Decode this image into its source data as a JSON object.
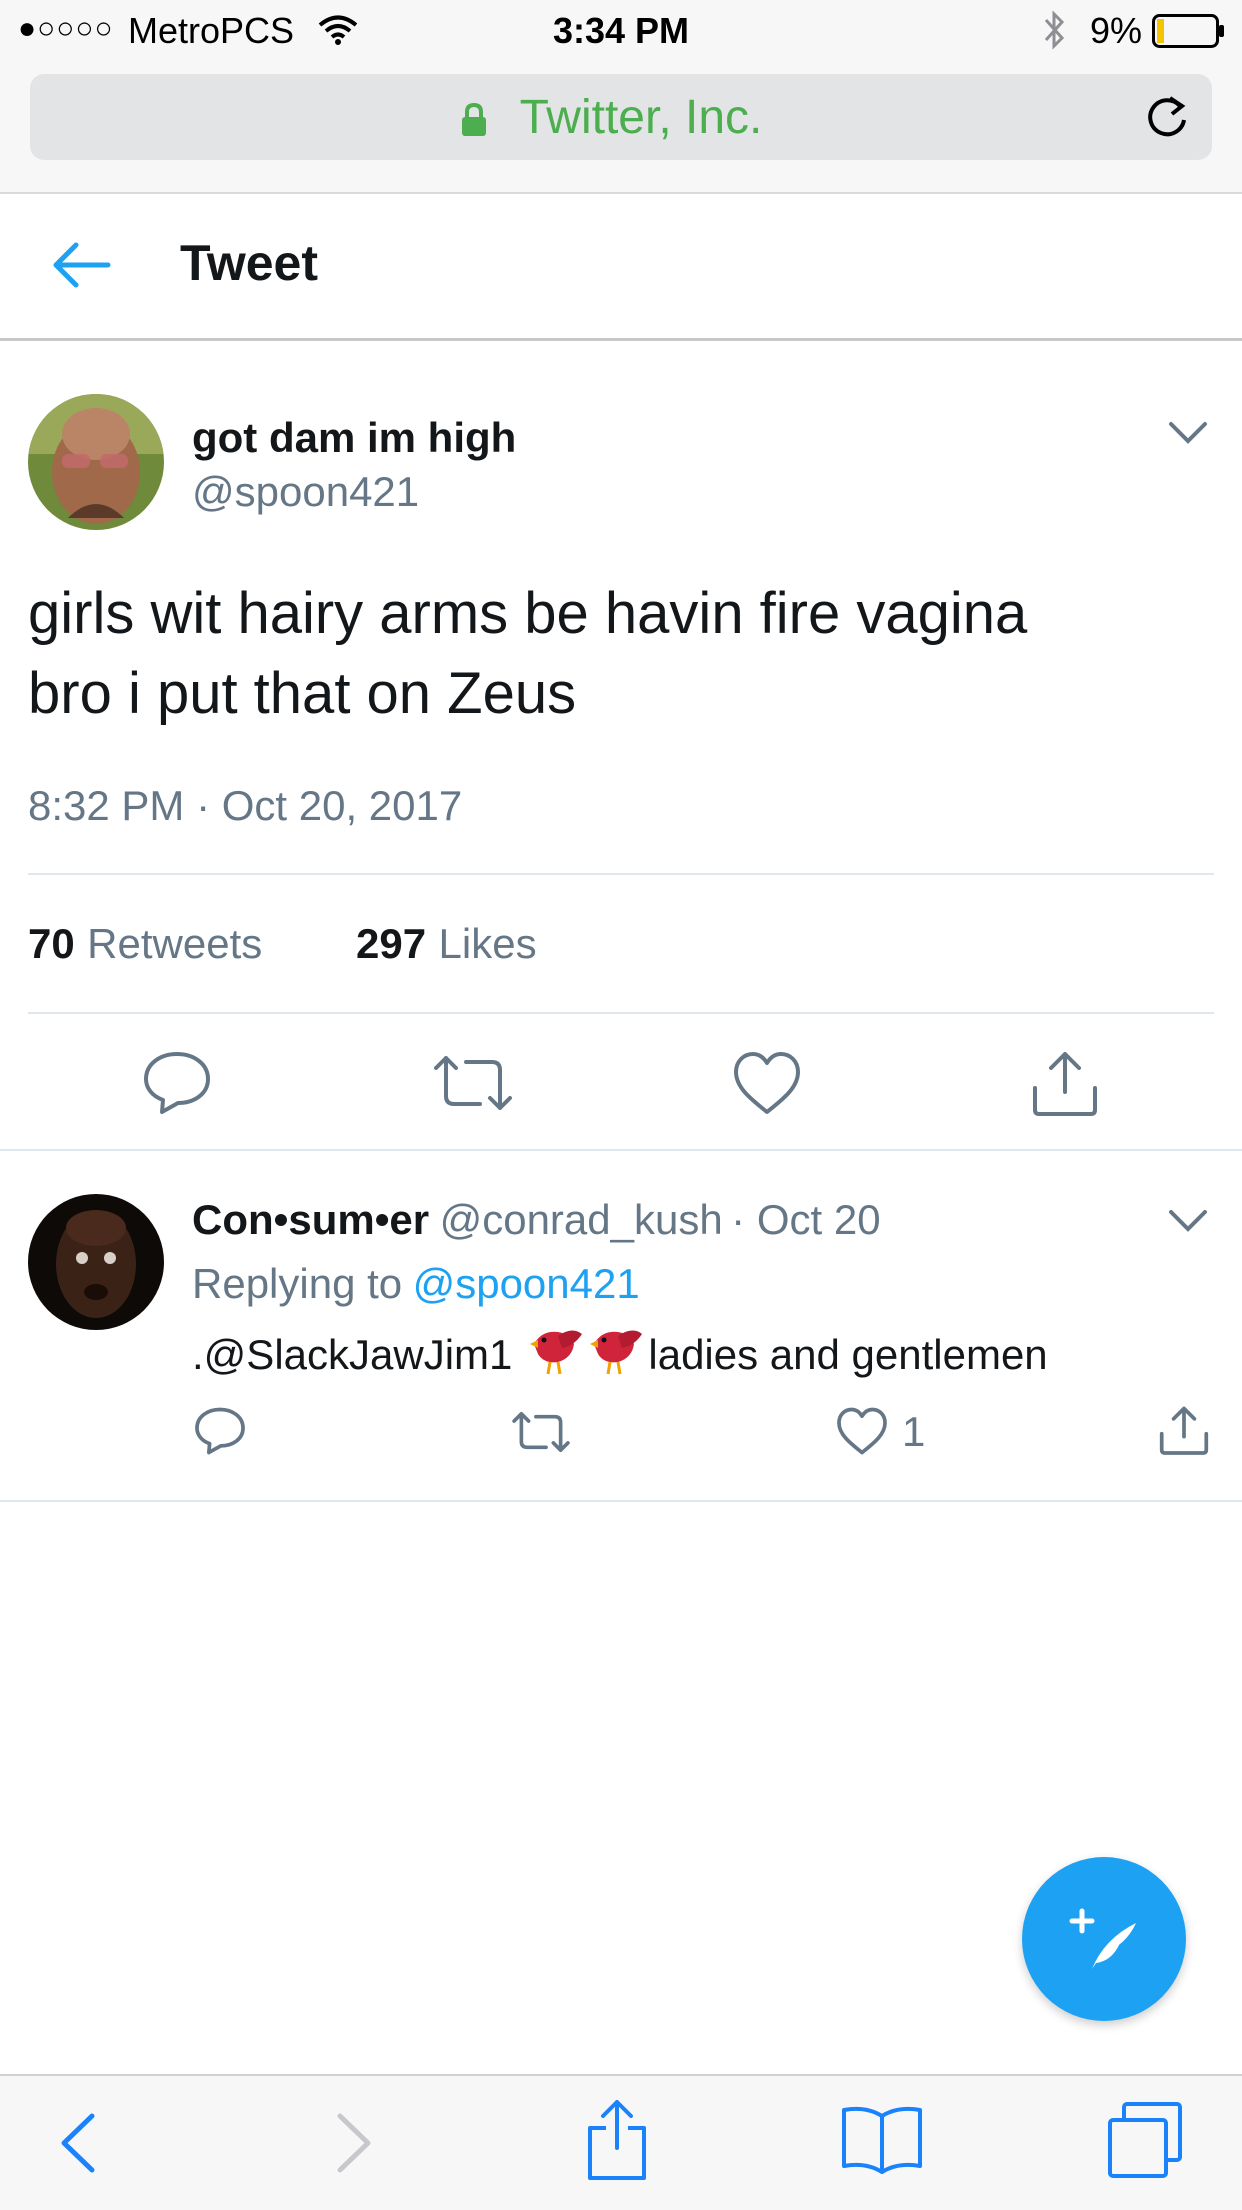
{
  "status_bar": {
    "signal": "●○○○○",
    "carrier": "MetroPCS",
    "time": "3:34 PM",
    "battery": "9%"
  },
  "url_bar": {
    "site_name": "Twitter, Inc.",
    "lock_color": "#4cae4f"
  },
  "header": {
    "title": "Tweet"
  },
  "tweet": {
    "display_name": "got dam im high",
    "handle": "@spoon421",
    "text_line1": "girls wit hairy arms be havin fire vagina",
    "text_line2": "bro i put that on Zeus",
    "timestamp": "8:32 PM · Oct 20, 2017",
    "retweets_count": "70",
    "retweets_label": "Retweets",
    "likes_count": "297",
    "likes_label": "Likes"
  },
  "reply": {
    "display_name": "Con•sum•er",
    "handle": "@conrad_kush",
    "date": "· Oct 20",
    "replying_prefix": "Replying to",
    "replying_to": "@spoon421",
    "text_mention": ".@SlackJawJim1",
    "text_rest": "ladies and gentlemen",
    "like_count": "1"
  },
  "colors": {
    "accent": "#1da1f2",
    "secondary_text": "#657786",
    "icon_gray": "#657786",
    "safari_blue": "#1a82fb"
  },
  "icons": [
    "back-arrow-icon",
    "chevron-down-icon",
    "reply-icon",
    "retweet-icon",
    "like-icon",
    "share-icon",
    "compose-tweet-icon",
    "lock-icon",
    "reload-icon",
    "wifi-icon",
    "bluetooth-icon",
    "battery-icon",
    "bird-emoji-icon"
  ]
}
